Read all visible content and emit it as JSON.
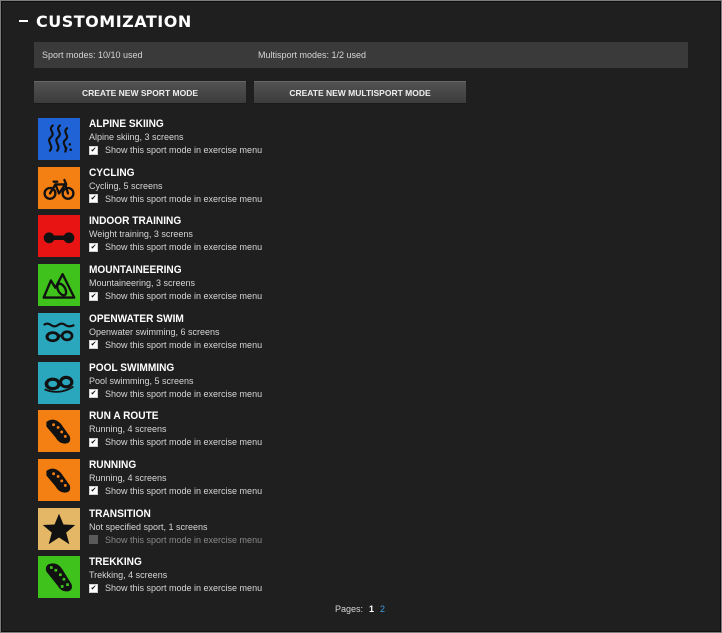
{
  "header": {
    "title": "CUSTOMIZATION"
  },
  "usage": {
    "sport": "Sport modes: 10/10 used",
    "multisport": "Multisport modes: 1/2 used"
  },
  "actions": {
    "create_sport": "CREATE NEW SPORT MODE",
    "create_multisport": "CREATE NEW MULTISPORT MODE"
  },
  "modes": [
    {
      "name": "ALPINE SKIING",
      "detail": "Alpine skiing, 3 screens",
      "show_label": "Show this sport mode in exercise menu",
      "checked": true,
      "icon": "alpine-skiing-icon",
      "color": "#1f63d6"
    },
    {
      "name": "CYCLING",
      "detail": "Cycling, 5 screens",
      "show_label": "Show this sport mode in exercise menu",
      "checked": true,
      "icon": "cycling-icon",
      "color": "#f47f12"
    },
    {
      "name": "INDOOR TRAINING",
      "detail": "Weight training, 3 screens",
      "show_label": "Show this sport mode in exercise menu",
      "checked": true,
      "icon": "dumbbell-icon",
      "color": "#e81414"
    },
    {
      "name": "MOUNTAINEERING",
      "detail": "Mountaineering, 3 screens",
      "show_label": "Show this sport mode in exercise menu",
      "checked": true,
      "icon": "mountaineering-icon",
      "color": "#3fc21c"
    },
    {
      "name": "OPENWATER SWIM",
      "detail": "Openwater swimming, 6 screens",
      "show_label": "Show this sport mode in exercise menu",
      "checked": true,
      "icon": "openwater-swim-icon",
      "color": "#2aa7bd"
    },
    {
      "name": "POOL SWIMMING",
      "detail": "Pool swimming, 5 screens",
      "show_label": "Show this sport mode in exercise menu",
      "checked": true,
      "icon": "swim-goggles-icon",
      "color": "#2aa7bd"
    },
    {
      "name": "RUN A ROUTE",
      "detail": "Running, 4 screens",
      "show_label": "Show this sport mode in exercise menu",
      "checked": true,
      "icon": "running-shoe-icon",
      "color": "#f47f12"
    },
    {
      "name": "RUNNING",
      "detail": "Running, 4 screens",
      "show_label": "Show this sport mode in exercise menu",
      "checked": true,
      "icon": "running-shoe-icon",
      "color": "#f47f12"
    },
    {
      "name": "TRANSITION",
      "detail": "Not specified sport, 1 screens",
      "show_label": "Show this sport mode in exercise menu",
      "checked": false,
      "icon": "star-icon",
      "color": "#e3b766"
    },
    {
      "name": "TREKKING",
      "detail": "Trekking, 4 screens",
      "show_label": "Show this sport mode in exercise menu",
      "checked": true,
      "icon": "boot-sole-icon",
      "color": "#3fc21c"
    }
  ],
  "pager": {
    "label": "Pages:",
    "current": "1",
    "next": "2"
  }
}
